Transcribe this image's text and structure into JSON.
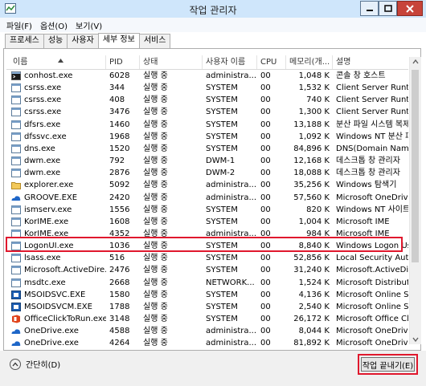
{
  "window": {
    "title": "작업 관리자",
    "controls": {
      "minimize": "minimize",
      "maximize": "maximize",
      "close": "close"
    }
  },
  "menu": [
    "파일(F)",
    "옵션(O)",
    "보기(V)"
  ],
  "tabs": [
    {
      "label": "프로세스",
      "active": false
    },
    {
      "label": "성능",
      "active": false
    },
    {
      "label": "사용자",
      "active": false
    },
    {
      "label": "세부 정보",
      "active": true
    },
    {
      "label": "서비스",
      "active": false
    }
  ],
  "columns": {
    "name": "이름",
    "pid": "PID",
    "status": "상태",
    "user": "사용자 이름",
    "cpu": "CPU",
    "memory": "메모리(개...",
    "description": "설명"
  },
  "processes": [
    {
      "name": "conhost.exe",
      "pid": "6028",
      "status": "실행 중",
      "user": "administra...",
      "cpu": "00",
      "memory": "1,048 K",
      "description": "콘솔 창 호스트",
      "icon": "console-icon"
    },
    {
      "name": "csrss.exe",
      "pid": "344",
      "status": "실행 중",
      "user": "SYSTEM",
      "cpu": "00",
      "memory": "1,532 K",
      "description": "Client Server Runti...",
      "icon": "app-icon"
    },
    {
      "name": "csrss.exe",
      "pid": "408",
      "status": "실행 중",
      "user": "SYSTEM",
      "cpu": "00",
      "memory": "740 K",
      "description": "Client Server Runti...",
      "icon": "app-icon"
    },
    {
      "name": "csrss.exe",
      "pid": "3476",
      "status": "실행 중",
      "user": "SYSTEM",
      "cpu": "00",
      "memory": "1,300 K",
      "description": "Client Server Runti...",
      "icon": "app-icon"
    },
    {
      "name": "dfsrs.exe",
      "pid": "1460",
      "status": "실행 중",
      "user": "SYSTEM",
      "cpu": "00",
      "memory": "13,188 K",
      "description": "분산 파일 시스템 복제...",
      "icon": "app-icon"
    },
    {
      "name": "dfssvc.exe",
      "pid": "1968",
      "status": "실행 중",
      "user": "SYSTEM",
      "cpu": "00",
      "memory": "1,092 K",
      "description": "Windows NT 분산 파...",
      "icon": "app-icon"
    },
    {
      "name": "dns.exe",
      "pid": "1520",
      "status": "실행 중",
      "user": "SYSTEM",
      "cpu": "00",
      "memory": "84,896 K",
      "description": "DNS(Domain Name...",
      "icon": "app-icon"
    },
    {
      "name": "dwm.exe",
      "pid": "792",
      "status": "실행 중",
      "user": "DWM-1",
      "cpu": "00",
      "memory": "12,168 K",
      "description": "데스크톱 창 관리자",
      "icon": "app-icon"
    },
    {
      "name": "dwm.exe",
      "pid": "2876",
      "status": "실행 중",
      "user": "DWM-2",
      "cpu": "00",
      "memory": "18,088 K",
      "description": "데스크톱 창 관리자",
      "icon": "app-icon"
    },
    {
      "name": "explorer.exe",
      "pid": "5092",
      "status": "실행 중",
      "user": "administra...",
      "cpu": "00",
      "memory": "35,256 K",
      "description": "Windows 탐색기",
      "icon": "folder-icon"
    },
    {
      "name": "GROOVE.EXE",
      "pid": "2420",
      "status": "실행 중",
      "user": "administra...",
      "cpu": "00",
      "memory": "57,560 K",
      "description": "Microsoft OneDrive...",
      "icon": "onedrive-icon"
    },
    {
      "name": "ismserv.exe",
      "pid": "1556",
      "status": "실행 중",
      "user": "SYSTEM",
      "cpu": "00",
      "memory": "820 K",
      "description": "Windows NT 사이트...",
      "icon": "app-icon"
    },
    {
      "name": "KorIME.exe",
      "pid": "1608",
      "status": "실행 중",
      "user": "SYSTEM",
      "cpu": "00",
      "memory": "1,004 K",
      "description": "Microsoft IME",
      "icon": "app-icon"
    },
    {
      "name": "KorIME.exe",
      "pid": "4352",
      "status": "실행 중",
      "user": "administra...",
      "cpu": "00",
      "memory": "984 K",
      "description": "Microsoft IME",
      "icon": "app-icon"
    },
    {
      "name": "LogonUI.exe",
      "pid": "1036",
      "status": "실행 중",
      "user": "SYSTEM",
      "cpu": "00",
      "memory": "8,840 K",
      "description": "Windows Logon Us...",
      "icon": "app-icon"
    },
    {
      "name": "lsass.exe",
      "pid": "516",
      "status": "실행 중",
      "user": "SYSTEM",
      "cpu": "00",
      "memory": "52,856 K",
      "description": "Local Security Auth...",
      "icon": "app-icon"
    },
    {
      "name": "Microsoft.ActiveDire...",
      "pid": "2476",
      "status": "실행 중",
      "user": "SYSTEM",
      "cpu": "00",
      "memory": "31,240 K",
      "description": "Microsoft.ActiveDire...",
      "icon": "app-icon"
    },
    {
      "name": "msdtc.exe",
      "pid": "2668",
      "status": "실행 중",
      "user": "NETWORK...",
      "cpu": "00",
      "memory": "1,524 K",
      "description": "Microsoft Distribute...",
      "icon": "app-icon"
    },
    {
      "name": "MSOIDSVC.EXE",
      "pid": "1580",
      "status": "실행 중",
      "user": "SYSTEM",
      "cpu": "00",
      "memory": "4,136 K",
      "description": "Microsoft Online Se...",
      "icon": "msoid-icon"
    },
    {
      "name": "MSOIDSVCM.EXE",
      "pid": "1788",
      "status": "실행 중",
      "user": "SYSTEM",
      "cpu": "00",
      "memory": "2,540 K",
      "description": "Microsoft Online Se...",
      "icon": "msoid-icon"
    },
    {
      "name": "OfficeClickToRun.exe",
      "pid": "3148",
      "status": "실행 중",
      "user": "SYSTEM",
      "cpu": "00",
      "memory": "26,172 K",
      "description": "Microsoft Office Cli...",
      "icon": "office-icon"
    },
    {
      "name": "OneDrive.exe",
      "pid": "4588",
      "status": "실행 중",
      "user": "administra...",
      "cpu": "00",
      "memory": "8,044 K",
      "description": "Microsoft OneDrive",
      "icon": "onedrive-icon"
    },
    {
      "name": "OneDrive.exe",
      "pid": "4264",
      "status": "실행 중",
      "user": "administra...",
      "cpu": "00",
      "memory": "81,892 K",
      "description": "Microsoft OneDrive",
      "icon": "onedrive-icon"
    }
  ],
  "selected_process": "GROOVE.EXE",
  "footer": {
    "fewer_details": "간단히(D)",
    "end_task": "작업 끝내기(E)"
  },
  "colors": {
    "titlebar": "#cfe6fb",
    "close": "#c7443a",
    "highlight": "#e0182d"
  }
}
